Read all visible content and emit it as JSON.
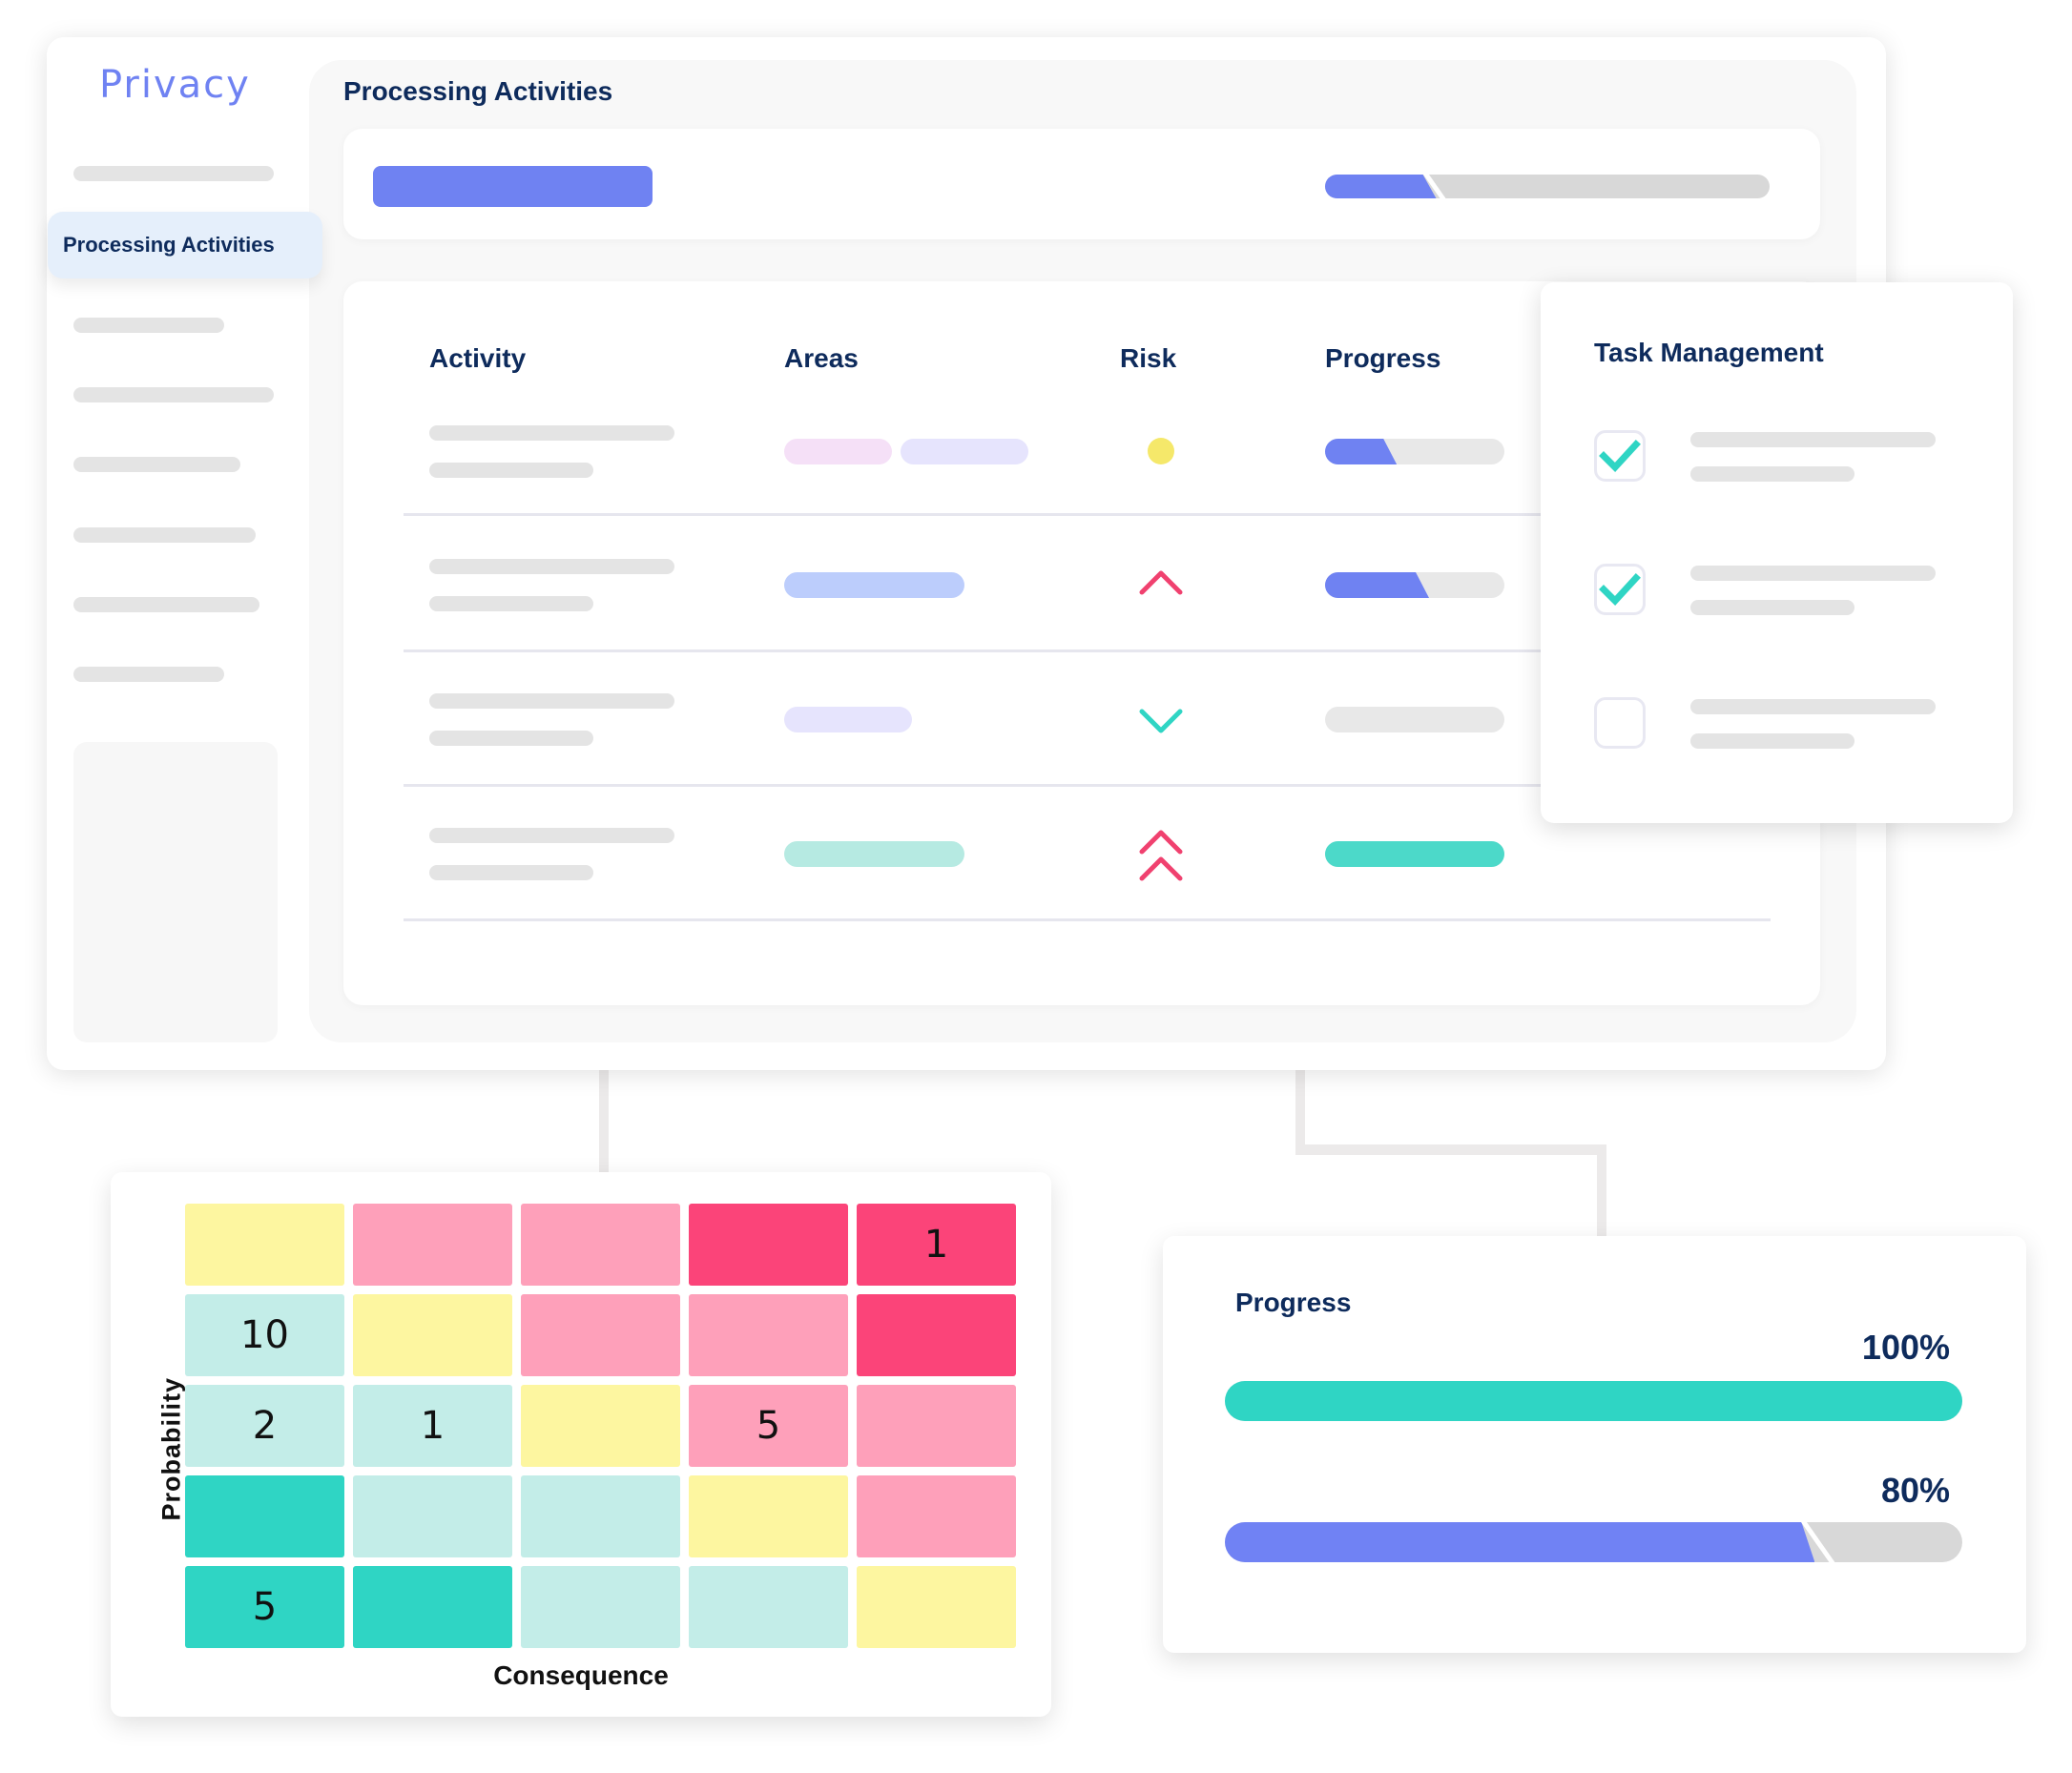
{
  "sidebar": {
    "brand": "Privacy",
    "active_item": "Processing Activities",
    "placeholder_items": 6
  },
  "main": {
    "title": "Processing Activities",
    "overall_progress": 0.25
  },
  "table": {
    "columns": [
      "Activity",
      "Areas",
      "Risk",
      "Progress"
    ],
    "rows": [
      {
        "areas": [
          "#f5e0f7",
          "#e6e4fd"
        ],
        "risk": "medium",
        "progress": 0.4,
        "progress_color": "#6f82f2"
      },
      {
        "areas": [
          "#bccdfc"
        ],
        "risk": "high",
        "progress": 0.58,
        "progress_color": "#6f82f2"
      },
      {
        "areas": [
          "#e6e4fd"
        ],
        "risk": "low",
        "progress": 0,
        "progress_color": "#6f82f2"
      },
      {
        "areas": [
          "#b6eae2"
        ],
        "risk": "very-high",
        "progress": 1.0,
        "progress_color": "#4cd9c9"
      }
    ]
  },
  "task_management": {
    "title": "Task Management",
    "tasks": [
      {
        "checked": true
      },
      {
        "checked": true
      },
      {
        "checked": false
      }
    ]
  },
  "risk_matrix": {
    "x_label": "Consequence",
    "y_label": "Probability",
    "rows": [
      [
        {
          "level": "medium",
          "value": ""
        },
        {
          "level": "high",
          "value": ""
        },
        {
          "level": "high",
          "value": ""
        },
        {
          "level": "critical",
          "value": ""
        },
        {
          "level": "critical",
          "value": "1"
        }
      ],
      [
        {
          "level": "low",
          "value": "10"
        },
        {
          "level": "medium",
          "value": ""
        },
        {
          "level": "high",
          "value": ""
        },
        {
          "level": "high",
          "value": ""
        },
        {
          "level": "critical",
          "value": ""
        }
      ],
      [
        {
          "level": "low",
          "value": "2"
        },
        {
          "level": "low",
          "value": "1"
        },
        {
          "level": "medium",
          "value": ""
        },
        {
          "level": "high",
          "value": "5"
        },
        {
          "level": "high",
          "value": ""
        }
      ],
      [
        {
          "level": "very-low",
          "value": ""
        },
        {
          "level": "low",
          "value": ""
        },
        {
          "level": "low",
          "value": ""
        },
        {
          "level": "medium",
          "value": ""
        },
        {
          "level": "high",
          "value": ""
        }
      ],
      [
        {
          "level": "very-low",
          "value": "5"
        },
        {
          "level": "very-low",
          "value": ""
        },
        {
          "level": "low",
          "value": ""
        },
        {
          "level": "low",
          "value": ""
        },
        {
          "level": "medium",
          "value": ""
        }
      ]
    ],
    "level_colors": {
      "very-low": "#2fd5c4",
      "low": "#c3ede8",
      "medium": "#fdf6a0",
      "high": "#fea0ba",
      "critical": "#fb4479"
    }
  },
  "progress_card": {
    "title": "Progress",
    "bars": [
      {
        "label": "100%",
        "value": 1.0,
        "color": "#2fd5c4"
      },
      {
        "label": "80%",
        "value": 0.8,
        "color": "#7082f4"
      }
    ]
  },
  "colors": {
    "accent": "#6f82f2",
    "navy": "#0e2b5c",
    "teal": "#2fd5c4",
    "risk_pink": "#f0416f",
    "risk_teal": "#2fd5c4",
    "risk_yellow": "#f5e86a"
  }
}
